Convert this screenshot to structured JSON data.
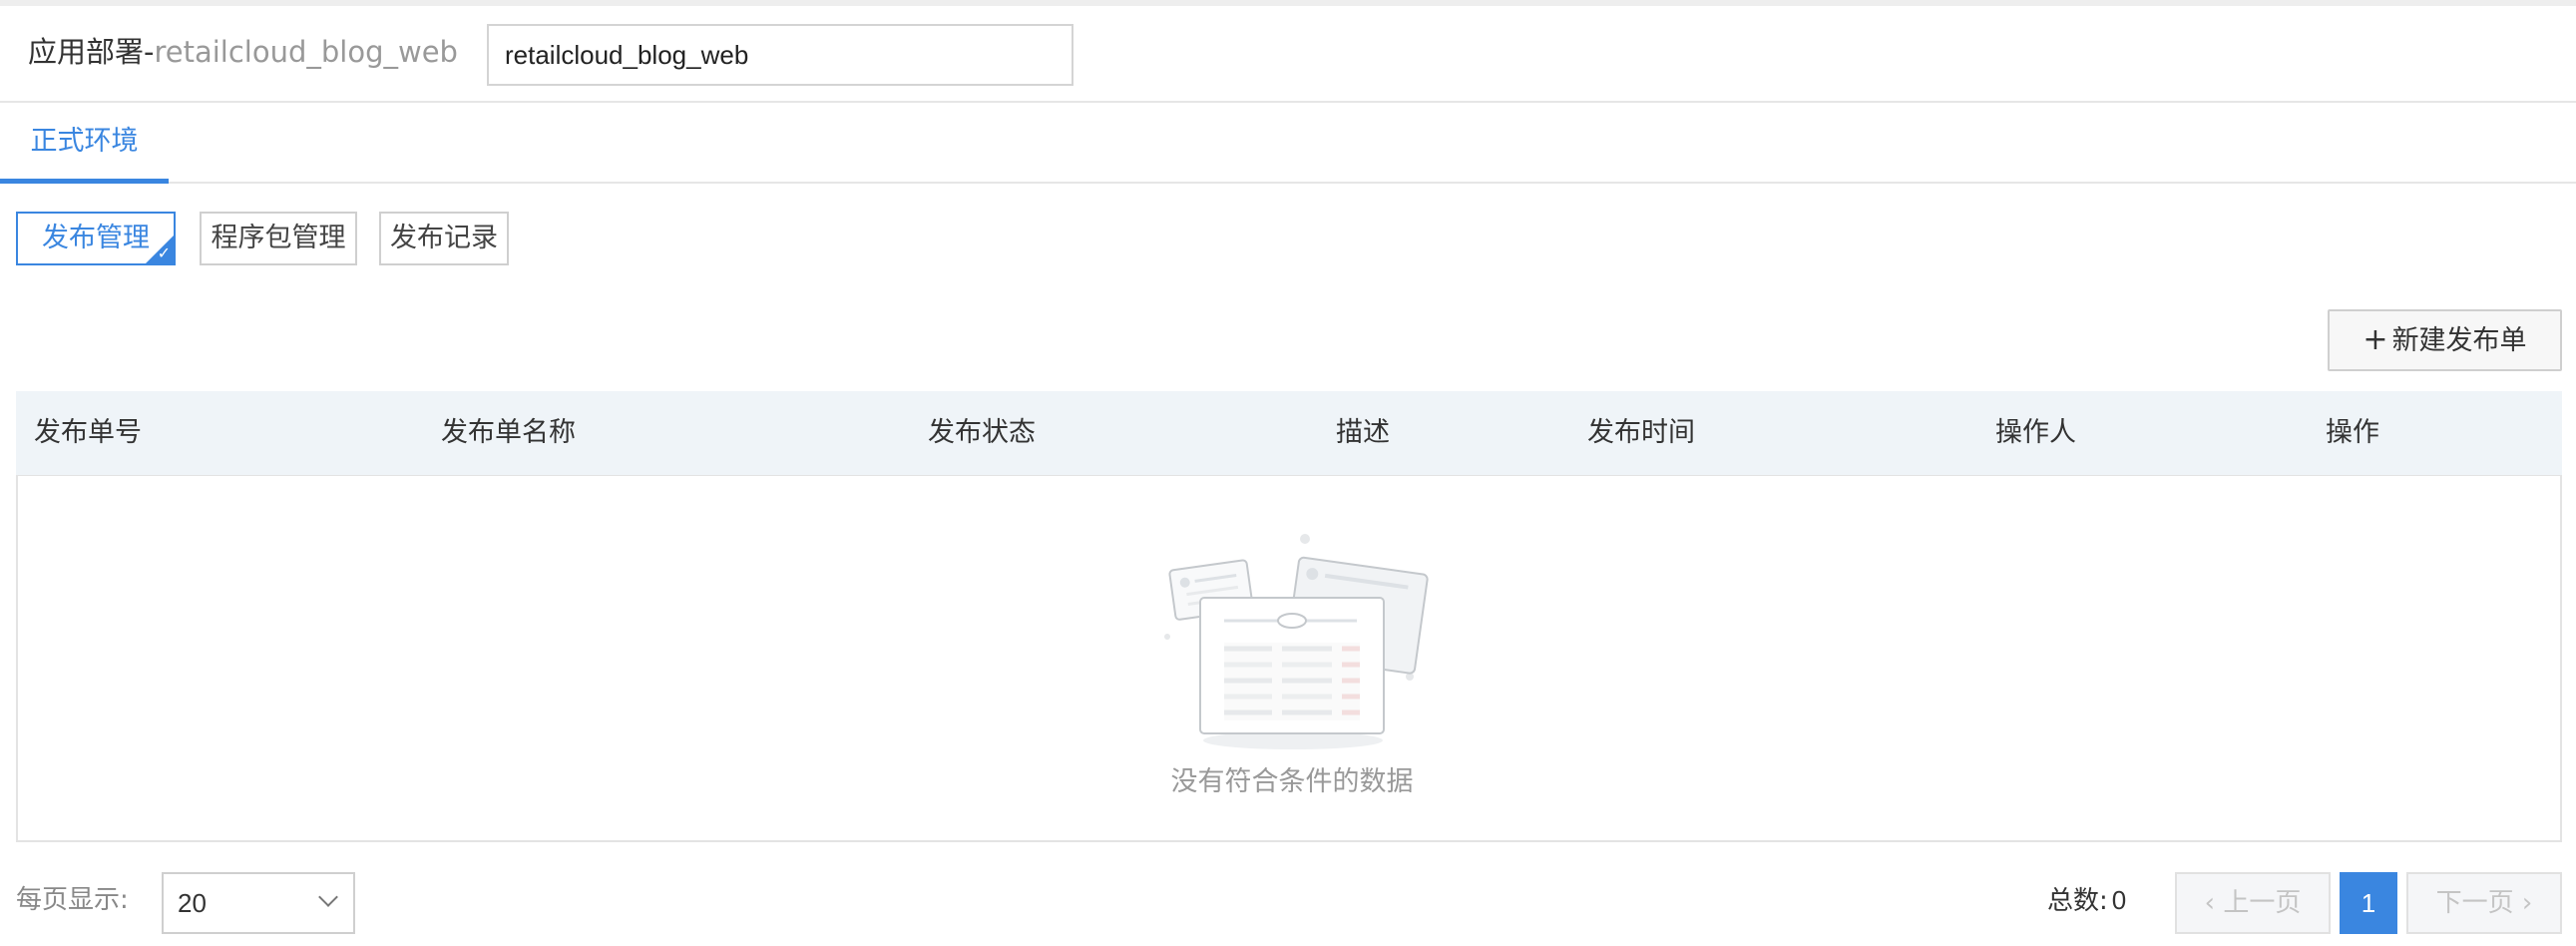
{
  "header": {
    "title_prefix": "应用部署-",
    "app_name": "retailcloud_blog_web",
    "input_value": "retailcloud_blog_web"
  },
  "tabs": [
    {
      "label": "正式环境",
      "active": true
    }
  ],
  "subtabs": [
    {
      "label": "发布管理",
      "active": true
    },
    {
      "label": "程序包管理",
      "active": false
    },
    {
      "label": "发布记录",
      "active": false
    }
  ],
  "toolbar": {
    "new_button_icon": "plus-icon",
    "new_button_label": "新建发布单"
  },
  "table": {
    "columns": [
      "发布单号",
      "发布单名称",
      "发布状态",
      "描述",
      "发布时间",
      "操作人",
      "操作"
    ],
    "rows": [],
    "empty_text": "没有符合条件的数据"
  },
  "pagination": {
    "page_size_label": "每页显示:",
    "page_size": "20",
    "total_label": "总数:",
    "total": "0",
    "prev_label": "上一页",
    "next_label": "下一页",
    "current_page": "1"
  },
  "colors": {
    "accent": "#3a86e0",
    "table_header_bg": "#eff4f8"
  }
}
